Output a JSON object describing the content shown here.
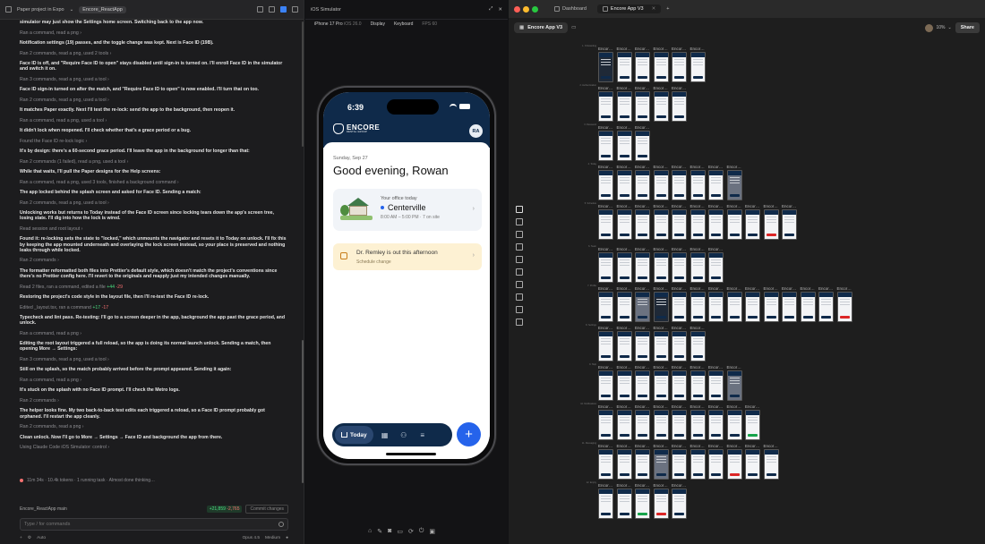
{
  "left": {
    "topbar": {
      "title": "Paper project in Expo",
      "chevron": "⌄",
      "branch_pill": "Encore_ReactApp"
    },
    "log": [
      {
        "kind": "b",
        "text": "simulator may just show the Settings home screen. Switching back to the app now."
      },
      {
        "kind": "m",
        "text": "Ran a command, read a png ›"
      },
      {
        "kind": "b",
        "text": "Notification settings (19) passes, and the toggle change was kept. Next is Face ID (19B)."
      },
      {
        "kind": "m",
        "text": "Ran 2 commands, read a png, used 2 tools ›"
      },
      {
        "kind": "b",
        "text": "Face ID is off, and \"Require Face ID to open\" stays disabled until sign-in is turned on. I'll enroll Face ID in the simulator and switch it on."
      },
      {
        "kind": "m",
        "text": "Ran 3 commands, read a png, used a tool ›"
      },
      {
        "kind": "b",
        "text": "Face ID sign-in turned on after the match, and \"Require Face ID to open\" is now enabled. I'll turn that on too."
      },
      {
        "kind": "m",
        "text": "Ran 2 commands, read a png, used a tool ›"
      },
      {
        "kind": "b",
        "text": "It matches Paper exactly. Next I'll test the re-lock: send the app to the background, then reopen it."
      },
      {
        "kind": "m",
        "text": "Ran a command, read a png, used a tool ›"
      },
      {
        "kind": "b",
        "text": "It didn't lock when reopened. I'll check whether that's a grace period or a bug."
      },
      {
        "kind": "m",
        "text": "Found the Face ID re-lock logic ›"
      },
      {
        "kind": "b",
        "text": "It's by design: there's a 60-second grace period. I'll leave the app in the background for longer than that:"
      },
      {
        "kind": "m",
        "text": "Ran 2 commands (1 failed), read a png, used a tool ›"
      },
      {
        "kind": "b",
        "text": "While that waits, I'll pull the Paper designs for the Help screens:"
      },
      {
        "kind": "m",
        "text": "Ran a command, read a png, used 3 tools, finished a background command ›"
      },
      {
        "kind": "b",
        "text": "The app locked behind the splash screen and asked for Face ID. Sending a match:"
      },
      {
        "kind": "m",
        "text": "Ran 2 commands, read a png, used a tool ›"
      },
      {
        "kind": "b",
        "text": "Unlocking works but returns to Today instead of the Face ID screen since locking tears down the app's screen tree, losing state. I'll dig into how the lock is wired."
      },
      {
        "kind": "m",
        "text": "Read session and root layout ›"
      },
      {
        "kind": "b",
        "text": "Found it: re-locking sets the state to \"locked,\" which unmounts the navigator and resets it to Today on unlock. I'll fix this by keeping the app mounted underneath and overlaying the lock screen instead, so your place is preserved and nothing leaks through while locked."
      },
      {
        "kind": "m",
        "text": "Ran 2 commands ›"
      },
      {
        "kind": "b",
        "text": "The formatter reformatted both files into Prettier's default style, which doesn't match the project's conventions since there's no Prettier config here. I'll revert to the originals and reapply just my intended changes manually."
      },
      {
        "kind": "m",
        "text": "Read 2 files, ran a command, edited a file",
        "plus": "+44",
        "minus": "-29"
      },
      {
        "kind": "b",
        "text": "Restoring the project's code style in the layout file, then I'll re-test the Face ID re-lock."
      },
      {
        "kind": "m",
        "text": "Edited _layout.tsx, ran a command",
        "plus": "+17",
        "minus": "-17"
      },
      {
        "kind": "b",
        "text": "Typecheck and lint pass. Re-testing: I'll go to a screen deeper in the app, background the app past the grace period, and unlock."
      },
      {
        "kind": "m",
        "text": "Ran a command, read a png ›"
      },
      {
        "kind": "b",
        "text": "Editing the root layout triggered a full reload, so the app is doing its normal launch unlock. Sending a match, then opening More → Settings:"
      },
      {
        "kind": "m",
        "text": "Ran 3 commands, read a png, used a tool ›"
      },
      {
        "kind": "b",
        "text": "Still on the splash, so the match probably arrived before the prompt appeared. Sending it again:"
      },
      {
        "kind": "m",
        "text": "Ran a command, read a png ›"
      },
      {
        "kind": "b",
        "text": "It's stuck on the splash with no Face ID prompt. I'll check the Metro logs."
      },
      {
        "kind": "m",
        "text": "Ran 2 commands ›"
      },
      {
        "kind": "b",
        "text": "The helper looks fine. My two back-to-back test edits each triggered a reload, so a Face ID prompt probably got orphaned. I'll restart the app cleanly."
      },
      {
        "kind": "m",
        "text": "Ran 2 commands, read a png ›"
      },
      {
        "kind": "b",
        "text": "Clean unlock. Now I'll go to More → Settings → Face ID and background the app from there."
      },
      {
        "kind": "m",
        "text": "Using Claude Code iOS Simulator: control ›"
      }
    ],
    "status_line": "11m 34s · 10.4k tokens · 1 running task · Almost done thinking…",
    "branch": "Encore_ReactApp  main",
    "diff_plus": "+21,859",
    "diff_minus": "-2,765",
    "commit_label": "Commit changes",
    "input_placeholder": "Type / for commands",
    "bottom_auto": "Auto",
    "bottom_model": "Opus 4.5",
    "bottom_effort": "Medium"
  },
  "sim": {
    "title": "iOS Simulator",
    "device": "iPhone 17 Pro",
    "os": "iOS 26.0",
    "display_menu": "Display",
    "keyboard_menu": "Keyboard",
    "fps": "FPS 60",
    "phone": {
      "time": "6:39",
      "logo": "ENCORE",
      "logo_sub": "DENTAL GROUP",
      "avatar": "RA",
      "date": "Sunday, Sep 27",
      "greeting": "Good evening, Rowan",
      "office_label": "Your office today",
      "office_city": "Centerville",
      "office_hours": "8:00 AM – 5:00 PM · 7 on site",
      "notice_title": "Dr. Remley is out this afternoon",
      "notice_sub": "Schedule change",
      "tab_today": "Today",
      "fab": "+"
    }
  },
  "design": {
    "tab_dashboard": "Dashboard",
    "tab_active": "Encore App V3",
    "new_tab": "+",
    "project": "Encore App V3",
    "zoom": "10%",
    "share": "Share",
    "frame_title": "Encor…",
    "rows": [
      {
        "label": "1. Onboarding",
        "count": 6,
        "style": [
          "dark2",
          "plain",
          "plain",
          "plain",
          "plain",
          "plain"
        ]
      },
      {
        "label": "2. Authentication",
        "count": 5,
        "style": [
          "plain",
          "plain",
          "plain",
          "plain",
          "plain"
        ]
      },
      {
        "label": "3. Password",
        "count": 3,
        "style": [
          "plain",
          "plain",
          "plain"
        ]
      },
      {
        "label": "4. Today",
        "count": 8,
        "style": [
          "plain",
          "plain",
          "plain",
          "plain",
          "plain",
          "plain",
          "plain",
          "dark"
        ]
      },
      {
        "label": "5. Schedule",
        "count": 11,
        "style": [
          "plain",
          "plain",
          "plain",
          "plain",
          "plain",
          "plain",
          "plain",
          "plain",
          "plain",
          "red",
          "plain"
        ]
      },
      {
        "label": "6. Team",
        "count": 7,
        "style": [
          "plain",
          "plain",
          "plain",
          "plain",
          "plain",
          "plain",
          "plain"
        ]
      },
      {
        "label": "7. Profile",
        "count": 14,
        "style": [
          "plain",
          "plain",
          "dark",
          "dark2",
          "plain",
          "plain",
          "plain",
          "plain",
          "plain",
          "plain",
          "plain",
          "plain",
          "plain",
          "red"
        ]
      },
      {
        "label": "8. Settings",
        "count": 6,
        "style": [
          "plain",
          "plain",
          "plain",
          "plain",
          "plain",
          "plain"
        ]
      },
      {
        "label": "9. Help",
        "count": 8,
        "style": [
          "plain",
          "plain",
          "plain",
          "plain",
          "plain",
          "plain",
          "plain",
          "dark"
        ]
      },
      {
        "label": "10. Notifications",
        "count": 9,
        "style": [
          "plain",
          "plain",
          "plain",
          "plain",
          "plain",
          "plain",
          "plain",
          "plain",
          "green"
        ]
      },
      {
        "label": "11. Messaging",
        "count": 10,
        "style": [
          "plain",
          "plain",
          "plain",
          "dark",
          "plain",
          "plain",
          "plain",
          "red",
          "plain",
          "plain"
        ]
      },
      {
        "label": "12. Empty",
        "count": 5,
        "style": [
          "plain",
          "plain",
          "green",
          "red",
          "plain"
        ]
      }
    ]
  },
  "colors": {
    "brand_navy": "#0f2a4a",
    "accent_blue": "#2563eb",
    "notice_bg": "#fdf1d3"
  }
}
